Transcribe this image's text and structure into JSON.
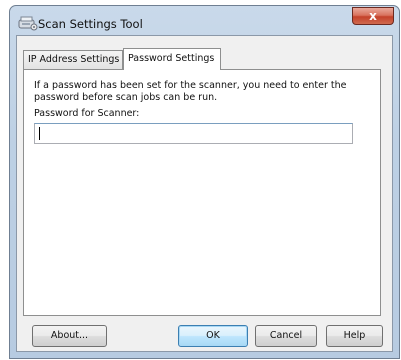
{
  "window": {
    "title": "Scan Settings Tool",
    "close_label": "x"
  },
  "tabs": [
    {
      "label": "IP Address Settings",
      "selected": false
    },
    {
      "label": "Password Settings",
      "selected": true
    }
  ],
  "panel": {
    "description": "If a password has been set for the scanner, you need to enter the password before scan jobs can be run.",
    "password_label": "Password for Scanner:",
    "password_value": ""
  },
  "buttons": {
    "about": "About...",
    "ok": "OK",
    "cancel": "Cancel",
    "help": "Help"
  },
  "icons": {
    "app": "scanner-icon",
    "close": "close-icon"
  },
  "colors": {
    "title_bar": "#bdd0e4",
    "close_button": "#c4412a",
    "default_button_border": "#3c7fb1",
    "dialog_background": "#f0f0f0"
  }
}
